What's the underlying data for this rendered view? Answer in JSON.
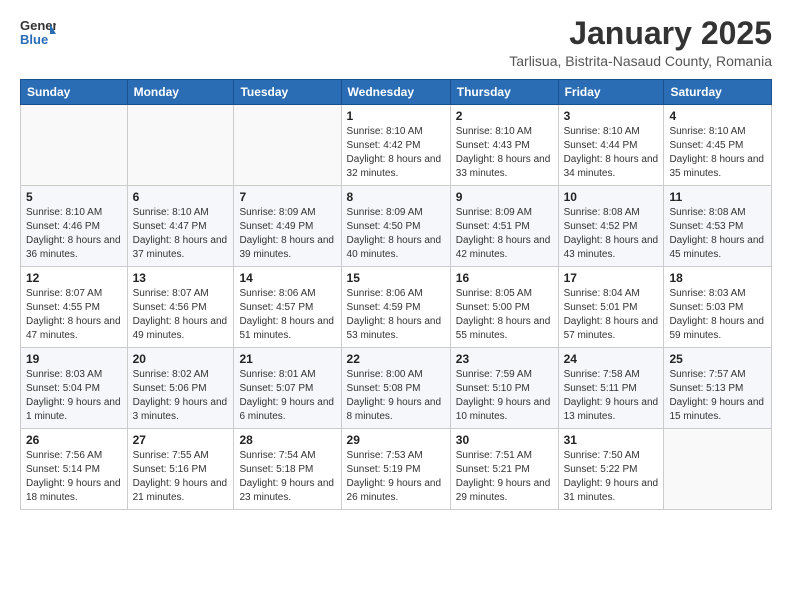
{
  "header": {
    "logo_general": "General",
    "logo_blue": "Blue",
    "month_title": "January 2025",
    "location": "Tarlisua, Bistrita-Nasaud County, Romania"
  },
  "weekdays": [
    "Sunday",
    "Monday",
    "Tuesday",
    "Wednesday",
    "Thursday",
    "Friday",
    "Saturday"
  ],
  "weeks": [
    [
      {
        "day": "",
        "info": ""
      },
      {
        "day": "",
        "info": ""
      },
      {
        "day": "",
        "info": ""
      },
      {
        "day": "1",
        "info": "Sunrise: 8:10 AM\nSunset: 4:42 PM\nDaylight: 8 hours and 32 minutes."
      },
      {
        "day": "2",
        "info": "Sunrise: 8:10 AM\nSunset: 4:43 PM\nDaylight: 8 hours and 33 minutes."
      },
      {
        "day": "3",
        "info": "Sunrise: 8:10 AM\nSunset: 4:44 PM\nDaylight: 8 hours and 34 minutes."
      },
      {
        "day": "4",
        "info": "Sunrise: 8:10 AM\nSunset: 4:45 PM\nDaylight: 8 hours and 35 minutes."
      }
    ],
    [
      {
        "day": "5",
        "info": "Sunrise: 8:10 AM\nSunset: 4:46 PM\nDaylight: 8 hours and 36 minutes."
      },
      {
        "day": "6",
        "info": "Sunrise: 8:10 AM\nSunset: 4:47 PM\nDaylight: 8 hours and 37 minutes."
      },
      {
        "day": "7",
        "info": "Sunrise: 8:09 AM\nSunset: 4:49 PM\nDaylight: 8 hours and 39 minutes."
      },
      {
        "day": "8",
        "info": "Sunrise: 8:09 AM\nSunset: 4:50 PM\nDaylight: 8 hours and 40 minutes."
      },
      {
        "day": "9",
        "info": "Sunrise: 8:09 AM\nSunset: 4:51 PM\nDaylight: 8 hours and 42 minutes."
      },
      {
        "day": "10",
        "info": "Sunrise: 8:08 AM\nSunset: 4:52 PM\nDaylight: 8 hours and 43 minutes."
      },
      {
        "day": "11",
        "info": "Sunrise: 8:08 AM\nSunset: 4:53 PM\nDaylight: 8 hours and 45 minutes."
      }
    ],
    [
      {
        "day": "12",
        "info": "Sunrise: 8:07 AM\nSunset: 4:55 PM\nDaylight: 8 hours and 47 minutes."
      },
      {
        "day": "13",
        "info": "Sunrise: 8:07 AM\nSunset: 4:56 PM\nDaylight: 8 hours and 49 minutes."
      },
      {
        "day": "14",
        "info": "Sunrise: 8:06 AM\nSunset: 4:57 PM\nDaylight: 8 hours and 51 minutes."
      },
      {
        "day": "15",
        "info": "Sunrise: 8:06 AM\nSunset: 4:59 PM\nDaylight: 8 hours and 53 minutes."
      },
      {
        "day": "16",
        "info": "Sunrise: 8:05 AM\nSunset: 5:00 PM\nDaylight: 8 hours and 55 minutes."
      },
      {
        "day": "17",
        "info": "Sunrise: 8:04 AM\nSunset: 5:01 PM\nDaylight: 8 hours and 57 minutes."
      },
      {
        "day": "18",
        "info": "Sunrise: 8:03 AM\nSunset: 5:03 PM\nDaylight: 8 hours and 59 minutes."
      }
    ],
    [
      {
        "day": "19",
        "info": "Sunrise: 8:03 AM\nSunset: 5:04 PM\nDaylight: 9 hours and 1 minute."
      },
      {
        "day": "20",
        "info": "Sunrise: 8:02 AM\nSunset: 5:06 PM\nDaylight: 9 hours and 3 minutes."
      },
      {
        "day": "21",
        "info": "Sunrise: 8:01 AM\nSunset: 5:07 PM\nDaylight: 9 hours and 6 minutes."
      },
      {
        "day": "22",
        "info": "Sunrise: 8:00 AM\nSunset: 5:08 PM\nDaylight: 9 hours and 8 minutes."
      },
      {
        "day": "23",
        "info": "Sunrise: 7:59 AM\nSunset: 5:10 PM\nDaylight: 9 hours and 10 minutes."
      },
      {
        "day": "24",
        "info": "Sunrise: 7:58 AM\nSunset: 5:11 PM\nDaylight: 9 hours and 13 minutes."
      },
      {
        "day": "25",
        "info": "Sunrise: 7:57 AM\nSunset: 5:13 PM\nDaylight: 9 hours and 15 minutes."
      }
    ],
    [
      {
        "day": "26",
        "info": "Sunrise: 7:56 AM\nSunset: 5:14 PM\nDaylight: 9 hours and 18 minutes."
      },
      {
        "day": "27",
        "info": "Sunrise: 7:55 AM\nSunset: 5:16 PM\nDaylight: 9 hours and 21 minutes."
      },
      {
        "day": "28",
        "info": "Sunrise: 7:54 AM\nSunset: 5:18 PM\nDaylight: 9 hours and 23 minutes."
      },
      {
        "day": "29",
        "info": "Sunrise: 7:53 AM\nSunset: 5:19 PM\nDaylight: 9 hours and 26 minutes."
      },
      {
        "day": "30",
        "info": "Sunrise: 7:51 AM\nSunset: 5:21 PM\nDaylight: 9 hours and 29 minutes."
      },
      {
        "day": "31",
        "info": "Sunrise: 7:50 AM\nSunset: 5:22 PM\nDaylight: 9 hours and 31 minutes."
      },
      {
        "day": "",
        "info": ""
      }
    ]
  ]
}
